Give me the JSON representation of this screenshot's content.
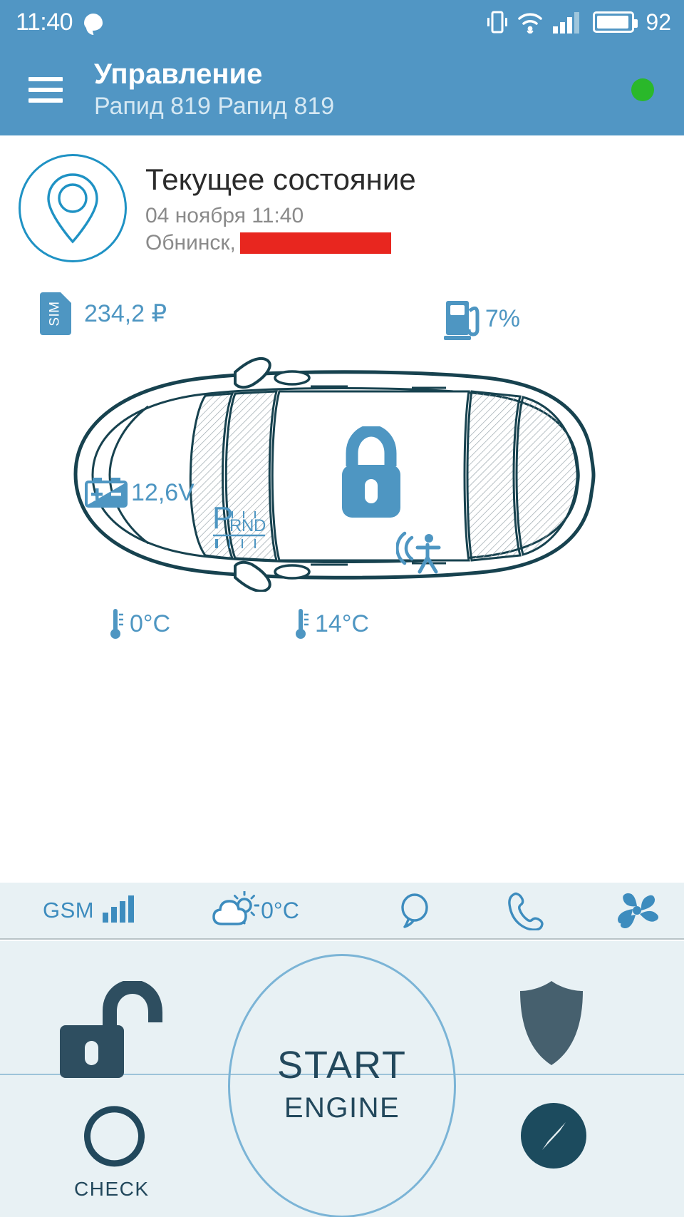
{
  "statusbar": {
    "time": "11:40",
    "battery_percent": "92",
    "icons": [
      "chat-bubble-icon",
      "vibrate-icon",
      "wifi-icon",
      "cellular-signal-icon",
      "battery-icon"
    ]
  },
  "appbar": {
    "title": "Управление",
    "subtitle": "Рапид 819 Рапид 819",
    "menu_icon": "hamburger-menu-icon",
    "status_dot_color": "#2ab82a"
  },
  "state_card": {
    "icon": "location-pin-icon",
    "title": "Текущее состояние",
    "datetime": "04 ноября 11:40",
    "city": "Обнинск,",
    "address_redacted": true,
    "redaction_color": "#e8261f"
  },
  "meters": {
    "sim": {
      "icon": "sim-card-icon",
      "label": "SIM",
      "value": "234,2 ₽"
    },
    "fuel": {
      "icon": "fuel-pump-icon",
      "value": "7%"
    }
  },
  "car": {
    "battery": {
      "icon": "car-battery-icon",
      "value": "12,6V"
    },
    "gearbox": {
      "icon": "prnd-selector-icon",
      "positions": [
        "P",
        "R",
        "N",
        "D"
      ],
      "selected": "P"
    },
    "lock": {
      "icon": "padlock-closed-icon",
      "state": "locked"
    },
    "alarm_sensor": {
      "icon": "shock-sensor-icon"
    },
    "temp_outside": {
      "icon": "thermometer-icon",
      "value": "0°C"
    },
    "temp_cabin": {
      "icon": "thermometer-icon",
      "value": "14°C"
    }
  },
  "bottom_status": {
    "gsm": {
      "label": "GSM",
      "icon": "signal-bars-icon"
    },
    "weather": {
      "icon": "cloud-sun-icon",
      "value": "0°C"
    },
    "chat": {
      "icon": "chat-bubble-icon"
    },
    "phone": {
      "icon": "phone-handset-icon"
    },
    "fan": {
      "icon": "fan-icon"
    }
  },
  "controls": {
    "unlock": {
      "icon": "padlock-open-icon"
    },
    "shield": {
      "icon": "shield-icon"
    },
    "check": {
      "icon": "check-circle-arrow-icon",
      "label": "CHECK"
    },
    "compass": {
      "icon": "compass-icon"
    },
    "start": {
      "line1": "START",
      "line2": "ENGINE"
    }
  },
  "colors": {
    "header": "#5196c4",
    "accent": "#4e96c2",
    "dark": "#22485c",
    "panel": "#e8f1f4"
  }
}
